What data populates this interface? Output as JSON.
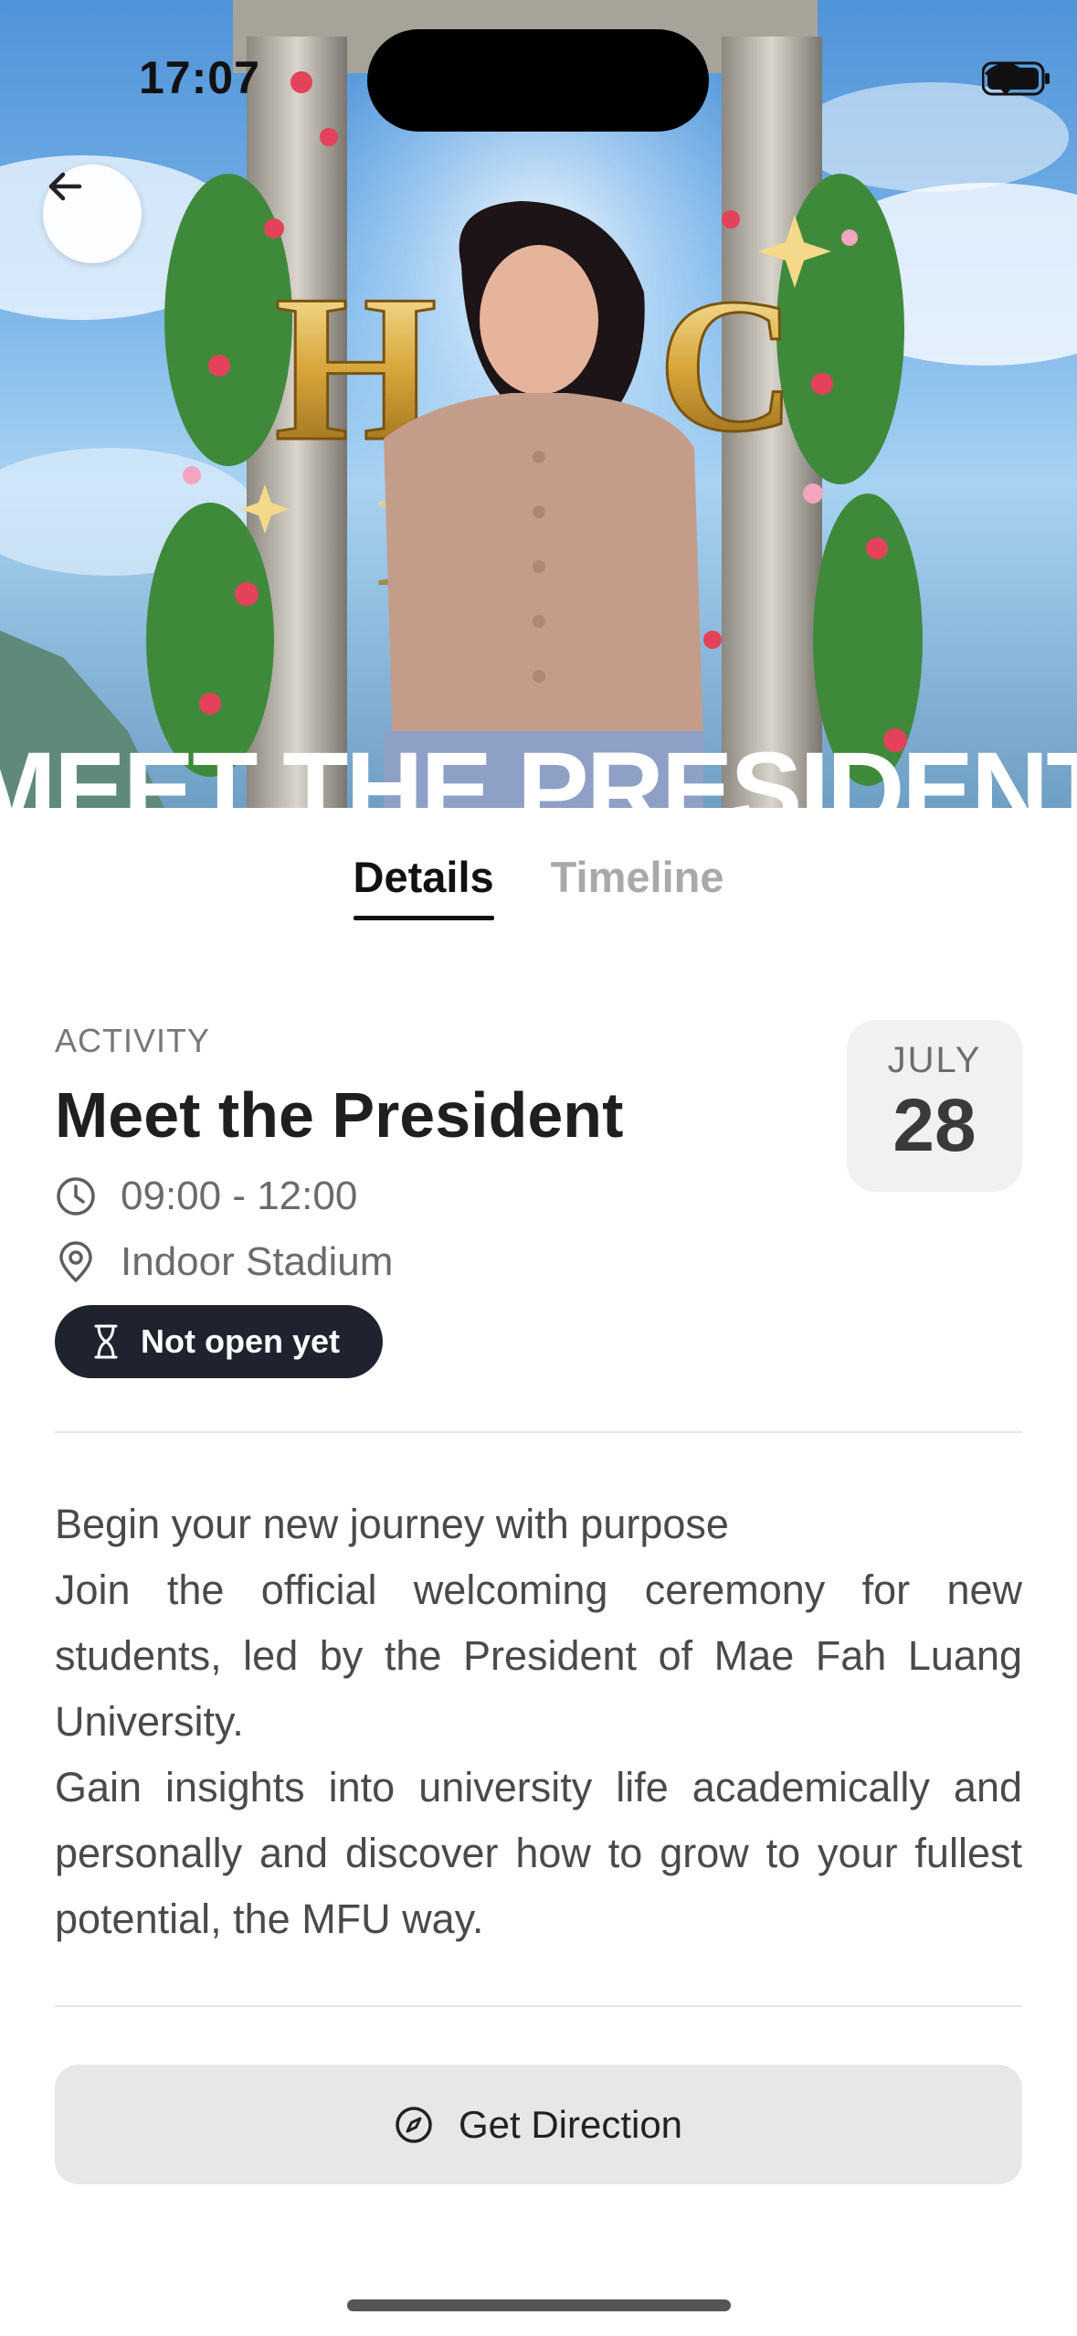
{
  "status_bar": {
    "time": "17:07"
  },
  "hero": {
    "banner_text": "MEET THE PRESIDENT"
  },
  "tabs": [
    {
      "label": "Details",
      "active": true
    },
    {
      "label": "Timeline",
      "active": false
    }
  ],
  "event": {
    "category": "ACTIVITY",
    "title": "Meet the President",
    "time": "09:00 - 12:00",
    "location": "Indoor Stadium",
    "status": "Not open yet",
    "date_month": "JULY",
    "date_day": "28"
  },
  "description": [
    "Begin your new journey with purpose",
    "Join the official welcoming ceremony for new students, led by the President of Mae Fah Luang University.",
    "Gain insights into university life academically and personally and discover how to grow to your fullest potential, the MFU way."
  ],
  "actions": {
    "direction_label": "Get Direction"
  },
  "icons": {
    "back": "arrow-left-icon",
    "time": "clock-icon",
    "location": "map-pin-icon",
    "status": "hourglass-icon",
    "direction": "compass-icon"
  },
  "colors": {
    "pill_bg": "#1f2330",
    "accent_text": "#111111",
    "inactive_tab": "#a9a9a9"
  }
}
